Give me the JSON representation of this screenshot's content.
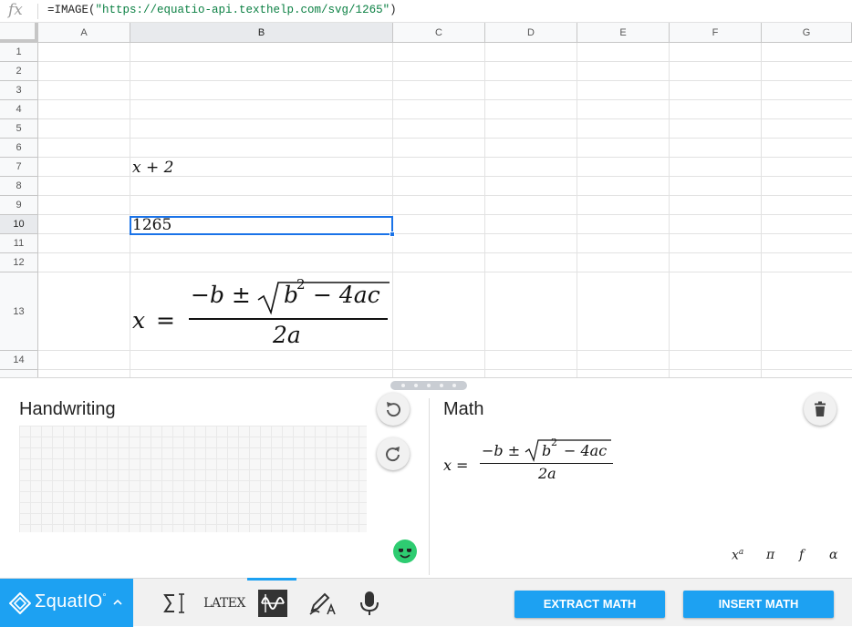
{
  "formula_bar": {
    "fx_label": "fx",
    "formula_prefix": "=IMAGE(",
    "formula_string": "\"https://equatio-api.texthelp.com/svg/1265\"",
    "formula_suffix": ")"
  },
  "columns": [
    "A",
    "B",
    "C",
    "D",
    "E",
    "F",
    "G"
  ],
  "selected_column": "B",
  "rows": [
    "1",
    "2",
    "3",
    "4",
    "5",
    "6",
    "7",
    "8",
    "9",
    "10",
    "11",
    "12",
    "13",
    "14"
  ],
  "selected_row": "10",
  "cells": {
    "B7": "x + 2",
    "B10": "1265",
    "B13": {
      "lhs": "x",
      "eq": "=",
      "num_prefix": "−b ±",
      "radicand_base": "b",
      "radicand_exp": "2",
      "radicand_rest": "− 4ac",
      "denominator": "2a"
    }
  },
  "handwriting_panel": {
    "title": "Handwriting"
  },
  "math_panel": {
    "title": "Math",
    "equation": {
      "lhs": "x",
      "eq": "=",
      "num_prefix": "−b ±",
      "radicand_base": "b",
      "radicand_exp": "2",
      "radicand_rest": "− 4ac",
      "denominator": "2a"
    },
    "symbol_buttons": [
      {
        "label": "x",
        "sup": "a",
        "name": "superscript-symbols-button"
      },
      {
        "label": "π",
        "sup": "",
        "name": "greek-pi-symbols-button"
      },
      {
        "label": "f",
        "sup": "",
        "name": "function-symbols-button"
      },
      {
        "label": "α",
        "sup": "",
        "name": "alpha-symbols-button"
      }
    ]
  },
  "toolbar": {
    "brand_name": "ΣquatIO",
    "brand_mark": "°",
    "latex_label": "LATEX",
    "extract_label": "EXTRACT MATH",
    "insert_label": "INSERT MATH"
  },
  "colors": {
    "brand": "#1da1f2",
    "selection": "#1a73e8",
    "string_green": "#0b8043"
  },
  "icons": [
    "fx-icon",
    "undo-icon",
    "redo-icon",
    "trash-icon",
    "smiley-icon",
    "equatio-logo-icon",
    "caret-up-icon",
    "math-input-icon",
    "latex-icon",
    "graph-icon",
    "handwriting-icon",
    "microphone-icon"
  ]
}
